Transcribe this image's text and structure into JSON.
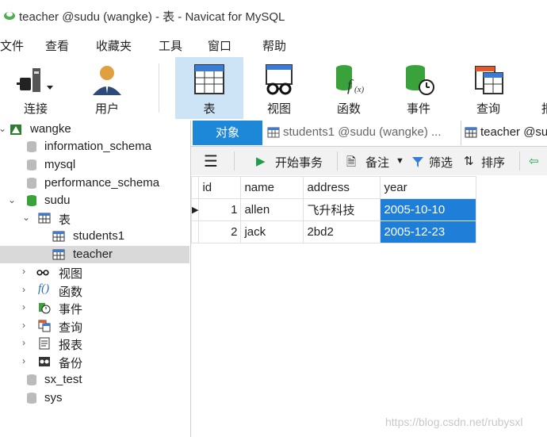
{
  "window": {
    "title": "teacher @sudu (wangke) - 表 - Navicat for MySQL"
  },
  "menu": [
    "文件",
    "查看",
    "收藏夹",
    "工具",
    "窗口",
    "帮助"
  ],
  "toolbar": {
    "items": [
      {
        "label": "连接",
        "icon": "connection-icon"
      },
      {
        "label": "用户",
        "icon": "user-icon"
      },
      {
        "label": "表",
        "icon": "table-icon",
        "active": true
      },
      {
        "label": "视图",
        "icon": "view-icon"
      },
      {
        "label": "函数",
        "icon": "function-icon"
      },
      {
        "label": "事件",
        "icon": "event-icon"
      },
      {
        "label": "查询",
        "icon": "query-icon"
      },
      {
        "label": "报",
        "icon": "report-icon"
      }
    ]
  },
  "tree": {
    "connection": "wangke",
    "databases": [
      "information_schema",
      "mysql",
      "performance_schema",
      "sudu"
    ],
    "tables_label": "表",
    "tables": [
      "students1",
      "teacher"
    ],
    "groups": [
      "视图",
      "函数",
      "事件",
      "查询",
      "报表",
      "备份"
    ],
    "more_dbs": [
      "sx_test",
      "sys"
    ]
  },
  "tabs": {
    "objects": "对象",
    "tab1": "students1 @sudu (wangke) ...",
    "tab2": "teacher @su"
  },
  "object_toolbar": {
    "begin_transaction": "开始事务",
    "note": "备注",
    "filter": "筛选",
    "sort": "排序"
  },
  "grid": {
    "columns": [
      "id",
      "name",
      "address",
      "year"
    ],
    "rows": [
      [
        "1",
        "allen",
        "飞升科技",
        "2005-10-10"
      ],
      [
        "2",
        "jack",
        "2bd2",
        "2005-12-23"
      ]
    ]
  },
  "watermark": "https://blog.csdn.net/rubysxl",
  "colors": {
    "accent": "#1e88d8",
    "selection": "#1f7fd8",
    "db_green": "#3aa23a"
  }
}
